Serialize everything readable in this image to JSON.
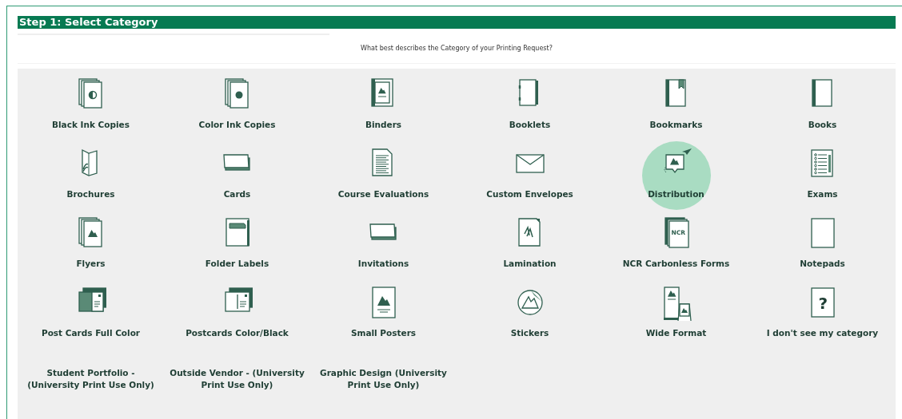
{
  "header": {
    "title": "Step 1: Select Category"
  },
  "question": "What best describes the Category of your Printing Request?",
  "categories": [
    {
      "label": "Black Ink Copies",
      "kind": "copiesbw",
      "selected": false
    },
    {
      "label": "Color Ink Copies",
      "kind": "copiescolor",
      "selected": false
    },
    {
      "label": "Binders",
      "kind": "binder",
      "selected": false
    },
    {
      "label": "Booklets",
      "kind": "booklet",
      "selected": false
    },
    {
      "label": "Bookmarks",
      "kind": "bookmark",
      "selected": false
    },
    {
      "label": "Books",
      "kind": "book",
      "selected": false
    },
    {
      "label": "Brochures",
      "kind": "brochure",
      "selected": false
    },
    {
      "label": "Cards",
      "kind": "card",
      "selected": false
    },
    {
      "label": "Course Evaluations",
      "kind": "document",
      "selected": false
    },
    {
      "label": "Custom Envelopes",
      "kind": "envelope",
      "selected": false
    },
    {
      "label": "Distribution",
      "kind": "distribution",
      "selected": true
    },
    {
      "label": "Exams",
      "kind": "checklist",
      "selected": false
    },
    {
      "label": "Flyers",
      "kind": "flyer",
      "selected": false
    },
    {
      "label": "Folder Labels",
      "kind": "folder",
      "selected": false
    },
    {
      "label": "Invitations",
      "kind": "card",
      "selected": false
    },
    {
      "label": "Lamination",
      "kind": "lamination",
      "selected": false
    },
    {
      "label": "NCR Carbonless Forms",
      "kind": "ncr",
      "icon_text": "NCR",
      "selected": false
    },
    {
      "label": "Notepads",
      "kind": "blank",
      "selected": false
    },
    {
      "label": "Post Cards Full Color",
      "kind": "postcardcolor",
      "selected": false
    },
    {
      "label": "Postcards Color/Black",
      "kind": "postcard",
      "selected": false
    },
    {
      "label": "Small Posters",
      "kind": "poster",
      "selected": false
    },
    {
      "label": "Stickers",
      "kind": "sticker",
      "selected": false
    },
    {
      "label": "Wide Format",
      "kind": "wide",
      "selected": false
    },
    {
      "label": "I don't see my category",
      "kind": "question",
      "icon_text": "?",
      "selected": false
    },
    {
      "label": "Student Portfolio - (University Print Use Only)",
      "kind": "text",
      "selected": false
    },
    {
      "label": "Outside Vendor - (University Print Use Only)",
      "kind": "text",
      "selected": false
    },
    {
      "label": "Graphic Design (University Print Use Only)",
      "kind": "text",
      "selected": false
    }
  ]
}
